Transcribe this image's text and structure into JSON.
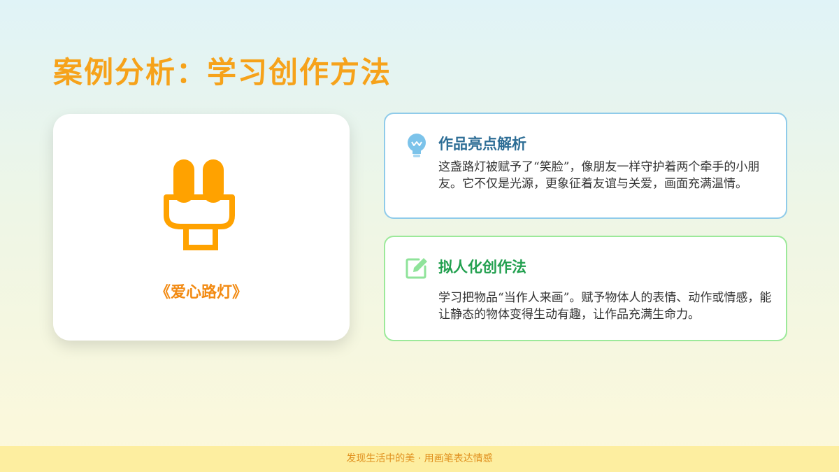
{
  "slide": {
    "title": "案例分析：学习创作方法",
    "artwork": {
      "caption": "《爱心路灯》",
      "icon": "plug-icon"
    },
    "highlights": {
      "icon": "lightbulb-icon",
      "heading": "作品亮点解析",
      "body": "这盏路灯被赋予了“笑脸”，像朋友一样守护着两个牵手的小朋友。它不仅是光源，更象征着友谊与关爱，画面充满温情。"
    },
    "method": {
      "icon": "edit-icon",
      "heading": "拟人化创作法",
      "body": "学习把物品“当作人来画”。赋予物体人的表情、动作或情感，能让静态的物体变得生动有趣，让作品充满生命力。"
    },
    "footer": "发现生活中的美 · 用画笔表达情感"
  },
  "colors": {
    "accent_orange": "#f6a21a",
    "blue_border": "#8fcbea",
    "green_border": "#9ce99a",
    "heading_blue": "#2e6e96",
    "heading_green": "#22a04f"
  }
}
